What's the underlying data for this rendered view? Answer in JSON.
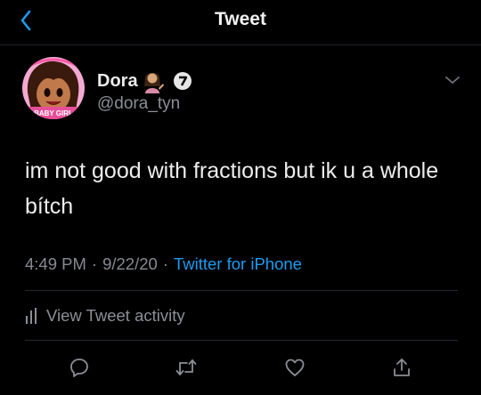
{
  "header": {
    "title": "Tweet",
    "back_icon": "chevron-left-icon"
  },
  "tweet": {
    "author": {
      "display_name": "Dora",
      "handle": "@dora_tyn",
      "avatar_badge": "BABY GIRL",
      "name_emoji": "person-tipping-hand-emoji",
      "verified_icon": "verified-badge-icon"
    },
    "text": "im not good with fractions but ik u a whole bítch",
    "time": "4:49 PM",
    "date": "9/22/20",
    "source": "Twitter for iPhone",
    "separator": "·",
    "activity_label": "View Tweet activity"
  },
  "actions": [
    {
      "name": "reply",
      "icon": "reply-icon"
    },
    {
      "name": "retweet",
      "icon": "retweet-icon"
    },
    {
      "name": "like",
      "icon": "heart-icon"
    },
    {
      "name": "share",
      "icon": "share-icon"
    }
  ],
  "colors": {
    "background": "#000000",
    "accent": "#1d9bf0",
    "muted_text": "#8a8f95",
    "divider": "#24282e"
  }
}
